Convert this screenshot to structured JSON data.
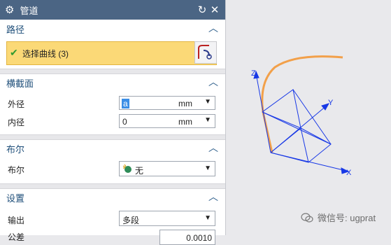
{
  "dialog": {
    "title": "管道",
    "title_icon": "gear-icon",
    "buttons": {
      "reset_icon": "reset-icon",
      "close_icon": "close-icon"
    }
  },
  "sections": {
    "path": {
      "title": "路径",
      "select_label": "选择曲线 (3)"
    },
    "cross_section": {
      "title": "横截面",
      "outer_label": "外径",
      "outer_value": "a",
      "outer_unit": "mm",
      "inner_label": "内径",
      "inner_value": "0",
      "inner_unit": "mm"
    },
    "boolean": {
      "title": "布尔",
      "label": "布尔",
      "value": "无"
    },
    "settings": {
      "title": "设置",
      "output_label": "输出",
      "output_value": "多段",
      "tolerance_label": "公差",
      "tolerance_value": "0.0010"
    }
  },
  "viewport": {
    "axis_labels": {
      "z": "Z",
      "y": "Y",
      "x": "X"
    },
    "curve_color": "#f2a04a",
    "axis_color": "#1838e6"
  },
  "watermark": {
    "text": "微信号: ugprat"
  }
}
